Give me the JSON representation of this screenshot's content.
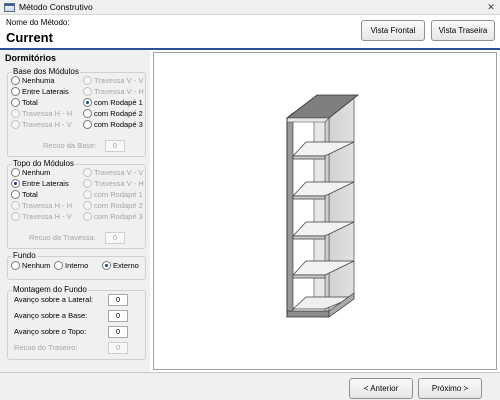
{
  "window": {
    "title": "Método Construtivo",
    "close_glyph": "✕"
  },
  "header": {
    "method_label": "Nome do Método:",
    "method_value": "Current"
  },
  "toolbar": {
    "front_view": "Vista Frontal",
    "back_view": "Vista Traseira"
  },
  "panel": {
    "title": "Dormitórios",
    "base": {
      "title": "Base dos Módulos",
      "options": [
        {
          "label": "Nenhuma",
          "checked": false,
          "enabled": true
        },
        {
          "label": "Travessa V - V",
          "checked": false,
          "enabled": false
        },
        {
          "label": "Entre Laterais",
          "checked": false,
          "enabled": true
        },
        {
          "label": "Travessa V - H",
          "checked": false,
          "enabled": false
        },
        {
          "label": "Total",
          "checked": false,
          "enabled": true
        },
        {
          "label": "com Rodapé 1",
          "checked": true,
          "enabled": true
        },
        {
          "label": "Travessa H - H",
          "checked": false,
          "enabled": false
        },
        {
          "label": "com Rodapé 2",
          "checked": false,
          "enabled": true
        },
        {
          "label": "Travessa H - V",
          "checked": false,
          "enabled": false
        },
        {
          "label": "com Rodapé 3",
          "checked": false,
          "enabled": true
        }
      ],
      "recuo_label": "Recuo da Base:",
      "recuo_value": "0"
    },
    "topo": {
      "title": "Topo do Módulos",
      "options": [
        {
          "label": "Nenhum",
          "checked": false,
          "enabled": true
        },
        {
          "label": "Travessa V - V",
          "checked": false,
          "enabled": false
        },
        {
          "label": "Entre Laterais",
          "checked": true,
          "enabled": true
        },
        {
          "label": "Travessa V - H",
          "checked": false,
          "enabled": false
        },
        {
          "label": "Total",
          "checked": false,
          "enabled": true
        },
        {
          "label": "com Rodapé 1",
          "checked": false,
          "enabled": false
        },
        {
          "label": "Travessa H - H",
          "checked": false,
          "enabled": false
        },
        {
          "label": "com Rodapé 2",
          "checked": false,
          "enabled": false
        },
        {
          "label": "Travessa H - V",
          "checked": false,
          "enabled": false
        },
        {
          "label": "com Rodapé 3",
          "checked": false,
          "enabled": false
        }
      ],
      "recuo_label": "Recuo da Travessa:",
      "recuo_value": "0"
    },
    "fundo": {
      "title": "Fundo",
      "options": [
        {
          "label": "Nenhum",
          "checked": false,
          "enabled": true
        },
        {
          "label": "Interno",
          "checked": false,
          "enabled": true
        },
        {
          "label": "Externo",
          "checked": true,
          "enabled": true
        }
      ]
    },
    "montagem": {
      "title": "Montagem do Fundo",
      "fields": [
        {
          "label": "Avanço sobre a Lateral:",
          "value": "0",
          "enabled": true
        },
        {
          "label": "Avanço sobre a Base:",
          "value": "0",
          "enabled": true
        },
        {
          "label": "Avanço sobre o Topo:",
          "value": "0",
          "enabled": true
        },
        {
          "label": "Recuo do Traseiro:",
          "value": "0",
          "enabled": false
        }
      ]
    }
  },
  "footer": {
    "prev": "< Anterior",
    "next": "Próximo >"
  },
  "colors": {
    "accent": "#2c4f9e",
    "panel_bg": "#f0f0f0"
  }
}
